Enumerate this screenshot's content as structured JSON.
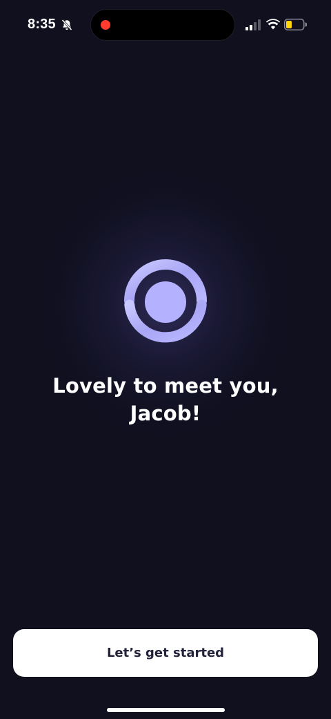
{
  "status_bar": {
    "time": "8:35",
    "mute_icon": "bell-slash-icon",
    "signal_icon": "cellular-signal-icon",
    "wifi_icon": "wifi-icon",
    "battery_icon": "battery-low-icon",
    "recording_color": "#ff3b30",
    "battery_color": "#ffd60a"
  },
  "hero": {
    "logo_icon": "ring-logo-icon",
    "logo_color": "#b4b2ff",
    "headline_line1": "Lovely to meet you,",
    "headline_line2": "Jacob!"
  },
  "actions": {
    "primary_label": "Let’s get started"
  },
  "colors": {
    "background": "#10101f",
    "button_background": "#ffffff",
    "button_text": "#22223a"
  }
}
